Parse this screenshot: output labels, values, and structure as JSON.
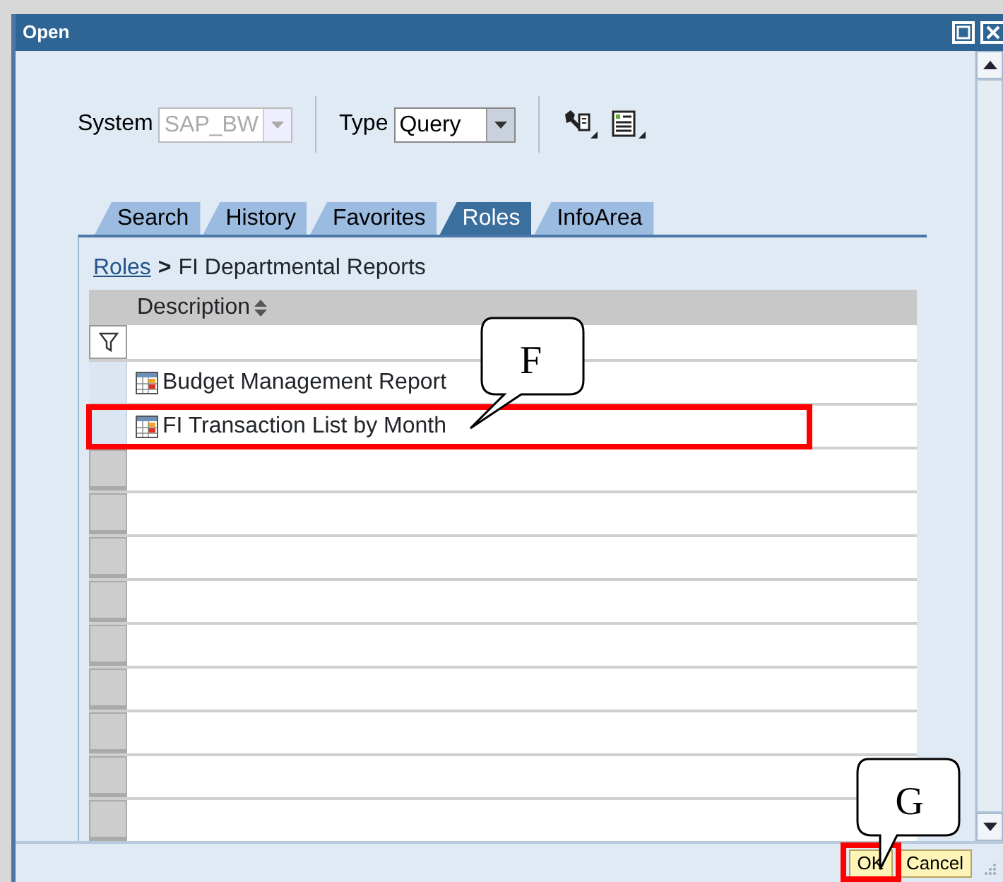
{
  "window": {
    "title": "Open"
  },
  "toolbar": {
    "system_label": "System",
    "system_value": "SAP_BW",
    "system_disabled": true,
    "type_label": "Type",
    "type_value": "Query"
  },
  "tabs": [
    {
      "label": "Search",
      "selected": false
    },
    {
      "label": "History",
      "selected": false
    },
    {
      "label": "Favorites",
      "selected": false
    },
    {
      "label": "Roles",
      "selected": true
    },
    {
      "label": "InfoArea",
      "selected": false
    }
  ],
  "breadcrumb": {
    "link": "Roles",
    "separator": ">",
    "current": "FI Departmental Reports"
  },
  "table": {
    "columns": [
      "Description"
    ],
    "rows": [
      {
        "description": "Budget Management Report",
        "highlighted": false
      },
      {
        "description": "FI Transaction List by Month",
        "highlighted": true
      }
    ]
  },
  "buttons": [
    {
      "label": "OK",
      "highlighted": true
    },
    {
      "label": "Cancel",
      "highlighted": false
    }
  ],
  "annotations": [
    {
      "label": "F"
    },
    {
      "label": "G"
    }
  ]
}
